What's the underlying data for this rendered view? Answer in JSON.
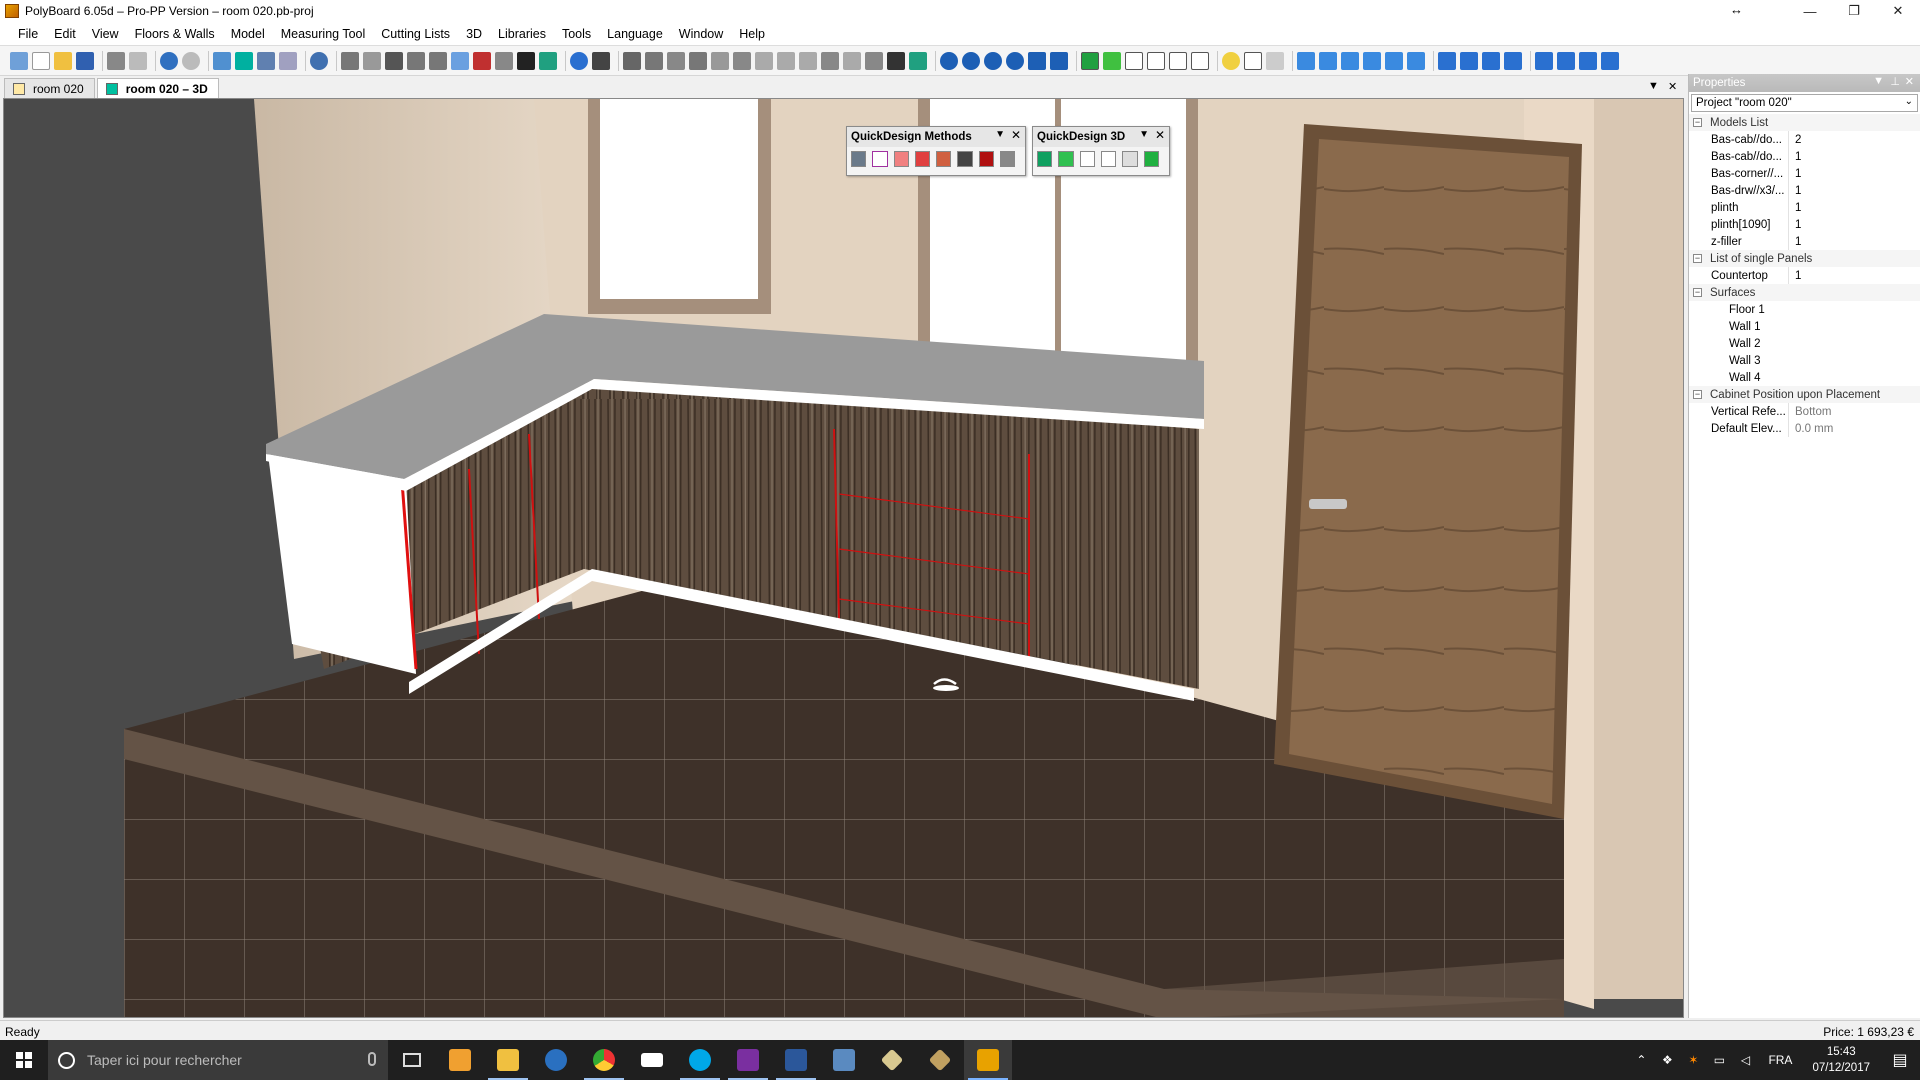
{
  "window": {
    "title": "PolyBoard 6.05d – Pro-PP Version – room 020.pb-proj",
    "minimize": "—",
    "restore": "❐",
    "close": "✕",
    "resize_glyph": "↔"
  },
  "menu": [
    "File",
    "Edit",
    "View",
    "Floors & Walls",
    "Model",
    "Measuring Tool",
    "Cutting Lists",
    "3D",
    "Libraries",
    "Tools",
    "Language",
    "Window",
    "Help"
  ],
  "tabs": [
    {
      "label": "room 020",
      "active": false
    },
    {
      "label": "room 020 – 3D",
      "active": true
    }
  ],
  "tab_controls": {
    "dropdown": "▼",
    "close": "✕"
  },
  "quickdesign_methods": {
    "title": "QuickDesign Methods",
    "dropdown": "▼",
    "close": "✕"
  },
  "quickdesign_3d": {
    "title": "QuickDesign 3D",
    "dropdown": "▼",
    "close": "✕"
  },
  "properties": {
    "header": "Properties",
    "header_controls": {
      "dropdown": "▼",
      "pin": "⊥",
      "close": "✕"
    },
    "project_select": "Project \"room 020\"",
    "select_caret": "⌄",
    "models_list": {
      "label": "Models List",
      "toggle": "−",
      "items": [
        {
          "name": "Bas-cab//do...",
          "value": "2"
        },
        {
          "name": "Bas-cab//do...",
          "value": "1"
        },
        {
          "name": "Bas-corner//...",
          "value": "1"
        },
        {
          "name": "Bas-drw//x3/...",
          "value": "1"
        },
        {
          "name": "plinth",
          "value": "1"
        },
        {
          "name": "plinth[1090]",
          "value": "1"
        },
        {
          "name": "z-filler",
          "value": "1"
        }
      ]
    },
    "single_panels": {
      "label": "List of single Panels",
      "toggle": "−",
      "items": [
        {
          "name": "Countertop",
          "value": "1"
        }
      ]
    },
    "surfaces": {
      "label": "Surfaces",
      "toggle": "−",
      "items": [
        "Floor 1",
        "Wall 1",
        "Wall 2",
        "Wall 3",
        "Wall 4"
      ]
    },
    "cabinet_position": {
      "label": "Cabinet Position upon Placement",
      "toggle": "−",
      "items": [
        {
          "name": "Vertical Refe...",
          "value": "Bottom"
        },
        {
          "name": "Default Elev...",
          "value": "0.0 mm"
        }
      ]
    }
  },
  "status": {
    "text": "Ready",
    "price": "Price: 1 693,23 €"
  },
  "taskbar": {
    "search_placeholder": "Taper ici pour rechercher",
    "language": "FRA",
    "time": "15:43",
    "date": "07/12/2017"
  },
  "colors": {
    "accent": "#0078d7",
    "wall": "#e3d3c0",
    "floor": "#3e3129",
    "cabinet_wood": "#5e4d3f",
    "countertop": "#9a9a9a",
    "door": "#8a6a4c"
  }
}
